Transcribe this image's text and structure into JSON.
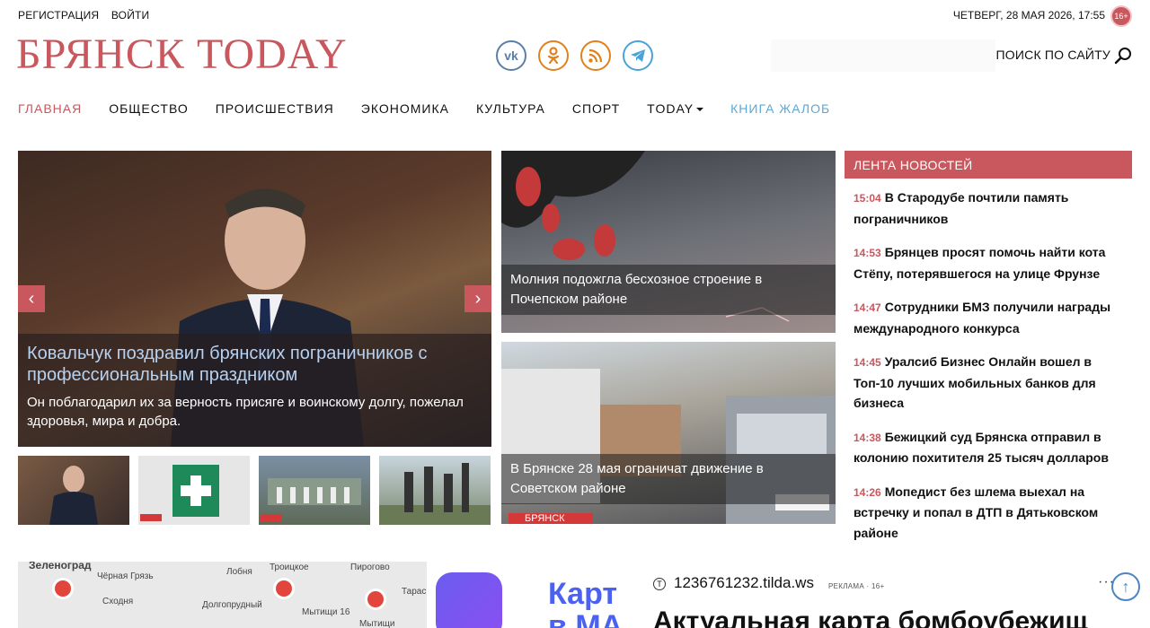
{
  "topbar": {
    "register": "РЕГИСТРАЦИЯ",
    "login": "ВОЙТИ",
    "date": "ЧЕТВЕРГ, 28 МАЯ 2026, 17:55",
    "age": "16+"
  },
  "logo": "БРЯНСК TODAY",
  "search": {
    "label": "ПОИСК ПО САЙТУ"
  },
  "nav": [
    {
      "label": "ГЛАВНАЯ"
    },
    {
      "label": "ОБЩЕСТВО"
    },
    {
      "label": "ПРОИСШЕСТВИЯ"
    },
    {
      "label": "ЭКОНОМИКА"
    },
    {
      "label": "КУЛЬТУРА"
    },
    {
      "label": "СПОРТ"
    },
    {
      "label": "TODAY"
    },
    {
      "label": "КНИГА ЖАЛОБ"
    }
  ],
  "slider": {
    "title": "Ковальчук поздравил брянских пограничников с профессиональным праздником",
    "description": "Он поблагодарил их за верность присяге и воинскому долгу, пожелал здоровья, мира и добра.",
    "prev": "‹",
    "next": "›"
  },
  "cards": [
    {
      "title": "Молния подожгла бесхозное строение в Почепском районе"
    },
    {
      "title": "В Брянске 28 мая ограничат движение в Советском районе",
      "brand": "БРЯНСК"
    }
  ],
  "feed": {
    "heading": "ЛЕНТА НОВОСТЕЙ",
    "items": [
      {
        "time": "15:04",
        "title": "В Стародубе почтили память пограничников"
      },
      {
        "time": "14:53",
        "title": "Брянцев просят помочь найти кота Стёпу, потерявшегося на улице Фрунзе"
      },
      {
        "time": "14:47",
        "title": "Сотрудники БМЗ получили награды международного конкурса"
      },
      {
        "time": "14:45",
        "title": "Уралсиб Бизнес Онлайн вошел в Топ-10 лучших мобильных банков для бизнеса"
      },
      {
        "time": "14:38",
        "title": "Бежицкий суд Брянска отправил в колонию похитителя 25 тысяч долларов"
      },
      {
        "time": "14:26",
        "title": "Мопедист без шлема выехал на встречку и попал в ДТП в Дятьковском районе"
      }
    ]
  },
  "map": {
    "labels": [
      "Зеленоград",
      "Чёрная Грязь",
      "Сходня",
      "Долгопрудный",
      "Лобня",
      "Троицкое",
      "Пирогово",
      "Мытищи 16",
      "Мытищи",
      "Тарас"
    ]
  },
  "ad": {
    "art_text": "Карт\nв МА",
    "domain_icon": "Т",
    "domain": "1236761232.tilda.ws",
    "meta": "РЕКЛАМА · 16+",
    "more": "···",
    "headline": "Актуальная карта бомбоубежищ"
  },
  "scroll_top": "↑"
}
